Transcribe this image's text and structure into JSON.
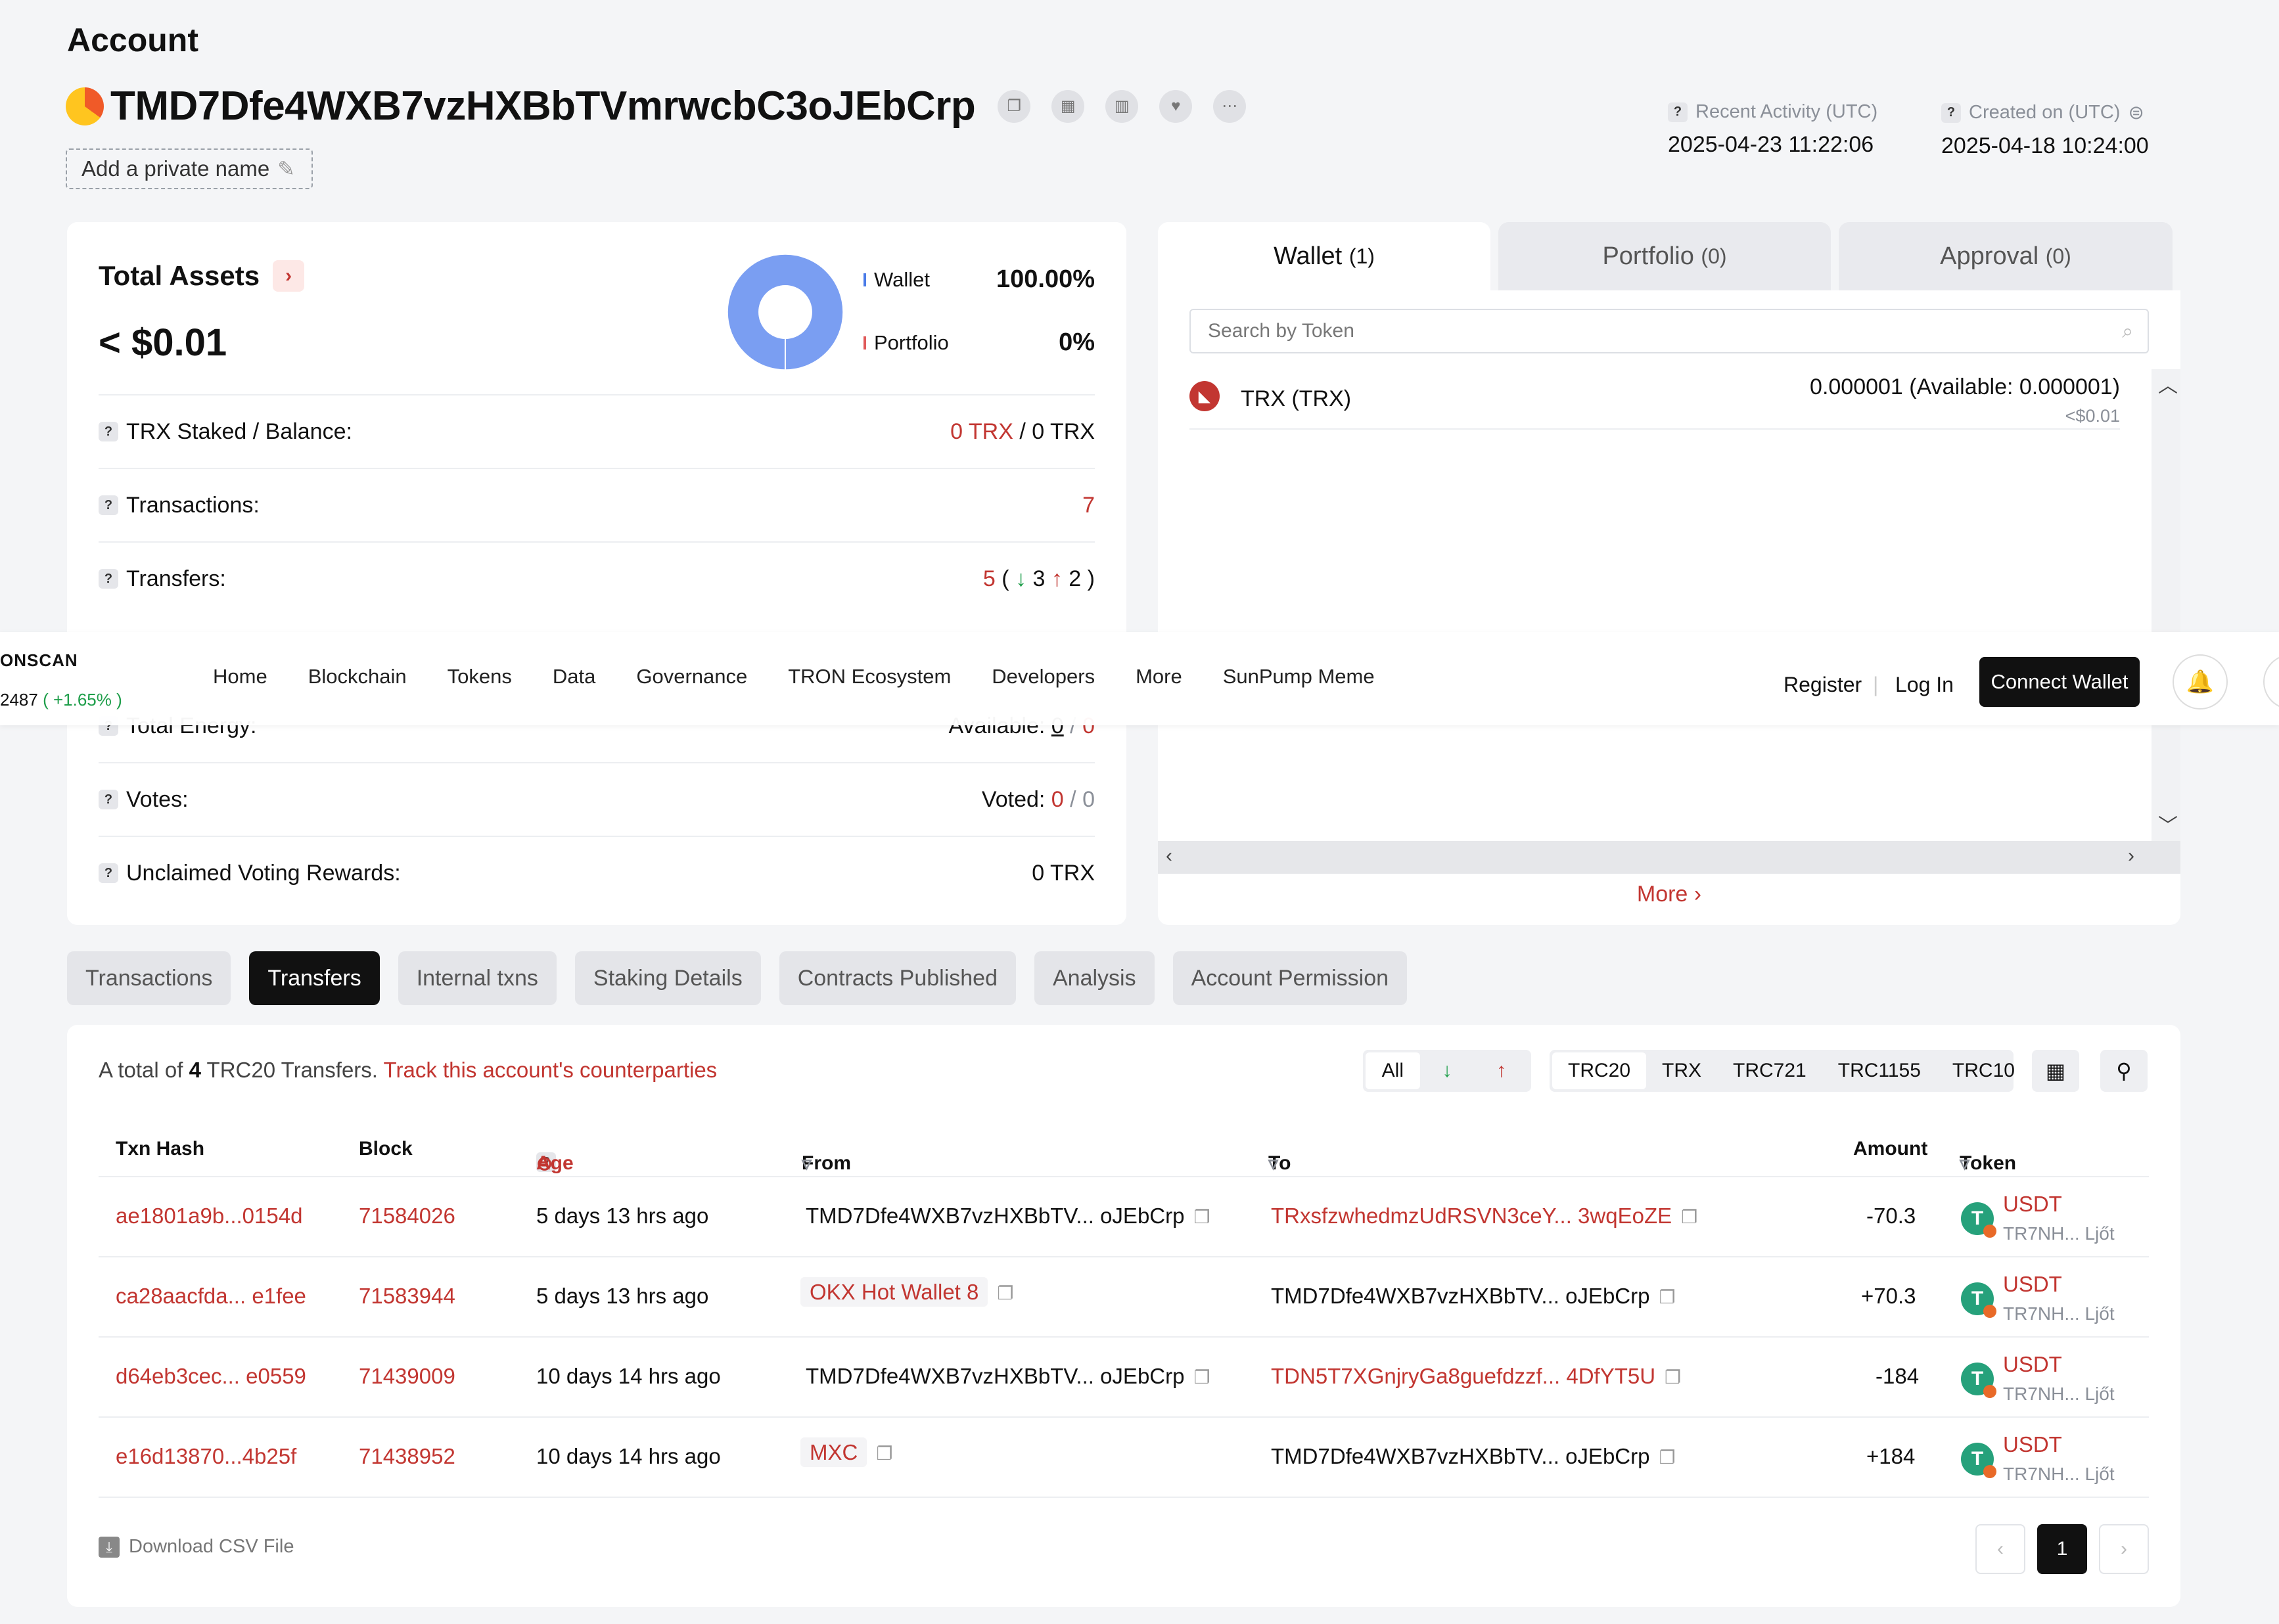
{
  "header": {
    "title": "Account",
    "address": "TMD7Dfe4WXB7vzHXBbTVmrwcbC3oJEbCrp",
    "private_name_label": "Add a private name",
    "recent_activity_label": "Recent Activity (UTC)",
    "recent_activity_value": "2025-04-23 11:22:06",
    "created_label": "Created on (UTC)",
    "created_value": "2025-04-18 10:24:00"
  },
  "assets": {
    "title": "Total Assets",
    "value": "< $0.01",
    "wallet_label": "Wallet",
    "wallet_pct": "100.00%",
    "portfolio_label": "Portfolio",
    "portfolio_pct": "0%",
    "wallet_color": "#7a9ef2",
    "rows": {
      "staked_label": "TRX Staked / Balance:",
      "staked_value": "0 TRX",
      "balance_value": "/ 0 TRX",
      "transactions_label": "Transactions:",
      "transactions_value": "7",
      "transfers_label": "Transfers:",
      "transfers_total": "5",
      "transfers_in": "3",
      "transfers_out": "2",
      "energy_label": "Total Energy:",
      "energy_available_label": "Available:",
      "energy_available": "0",
      "energy_total": "0",
      "votes_label": "Votes:",
      "votes_voted_label": "Voted:",
      "votes_voted": "0",
      "votes_total": "0",
      "rewards_label": "Unclaimed Voting Rewards:",
      "rewards_value": "0 TRX"
    }
  },
  "tokens": {
    "tab_wallet": "Wallet",
    "tab_wallet_count": "(1)",
    "tab_portfolio": "Portfolio",
    "tab_portfolio_count": "(0)",
    "tab_approval": "Approval",
    "tab_approval_count": "(0)",
    "search_placeholder": "Search by Token",
    "trx_name": "TRX (TRX)",
    "trx_amount": "0.000001 (Available: 0.000001)",
    "trx_usd": "<$0.01",
    "more_label": "More"
  },
  "nav": {
    "brand": "ONSCAN",
    "price": "2487",
    "price_change": "( +1.65% )",
    "items": [
      "Home",
      "Blockchain",
      "Tokens",
      "Data",
      "Governance",
      "TRON Ecosystem",
      "Developers",
      "More",
      "SunPump Meme"
    ],
    "register": "Register",
    "login": "Log In",
    "connect": "Connect Wallet"
  },
  "section_tabs": [
    "Transactions",
    "Transfers",
    "Internal txns",
    "Staking Details",
    "Contracts Published",
    "Analysis",
    "Account Permission"
  ],
  "transfers": {
    "total_prefix": "A total of",
    "total_count": "4",
    "total_suffix": "TRC20 Transfers.",
    "track_link": "Track this account's counterparties",
    "dir_all": "All",
    "types": [
      "TRC20",
      "TRX",
      "TRC721",
      "TRC1155",
      "TRC10"
    ],
    "columns": {
      "hash": "Txn Hash",
      "block": "Block",
      "age": "Age",
      "from": "From",
      "to": "To",
      "amount": "Amount",
      "token": "Token"
    },
    "rows": [
      {
        "hash": "ae1801a9b...0154d",
        "block": "71584026",
        "age": "5 days 13 hrs ago",
        "from": "TMD7Dfe4WXB7vzHXBbTV...  oJEbCrp",
        "to": "TRxsfzwhedmzUdRSVN3ceY... 3wqEoZE",
        "amount": "-70.3",
        "token": "USDT",
        "token_addr": "TR7NH...  Ljőt"
      },
      {
        "hash": "ca28aacfda... e1fee",
        "block": "71583944",
        "age": "5 days 13 hrs ago",
        "from": "OKX Hot Wallet 8",
        "to": "TMD7Dfe4WXB7vzHXBbTV...  oJEbCrp",
        "amount": "+70.3",
        "token": "USDT",
        "token_addr": "TR7NH...  Ljőt"
      },
      {
        "hash": "d64eb3cec... e0559",
        "block": "71439009",
        "age": "10 days 14 hrs ago",
        "from": "TMD7Dfe4WXB7vzHXBbTV...  oJEbCrp",
        "to": "TDN5T7XGnjryGa8guefdzzf...  4DfYT5U",
        "amount": "-184",
        "token": "USDT",
        "token_addr": "TR7NH...  Ljőt"
      },
      {
        "hash": "e16d13870...4b25f",
        "block": "71438952",
        "age": "10 days 14 hrs ago",
        "from": "MXC",
        "to": "TMD7Dfe4WXB7vzHXBbTV...  oJEbCrp",
        "amount": "+184",
        "token": "USDT",
        "token_addr": "TR7NH...  Ljőt"
      }
    ],
    "csv_label": "Download CSV File",
    "page": "1"
  }
}
